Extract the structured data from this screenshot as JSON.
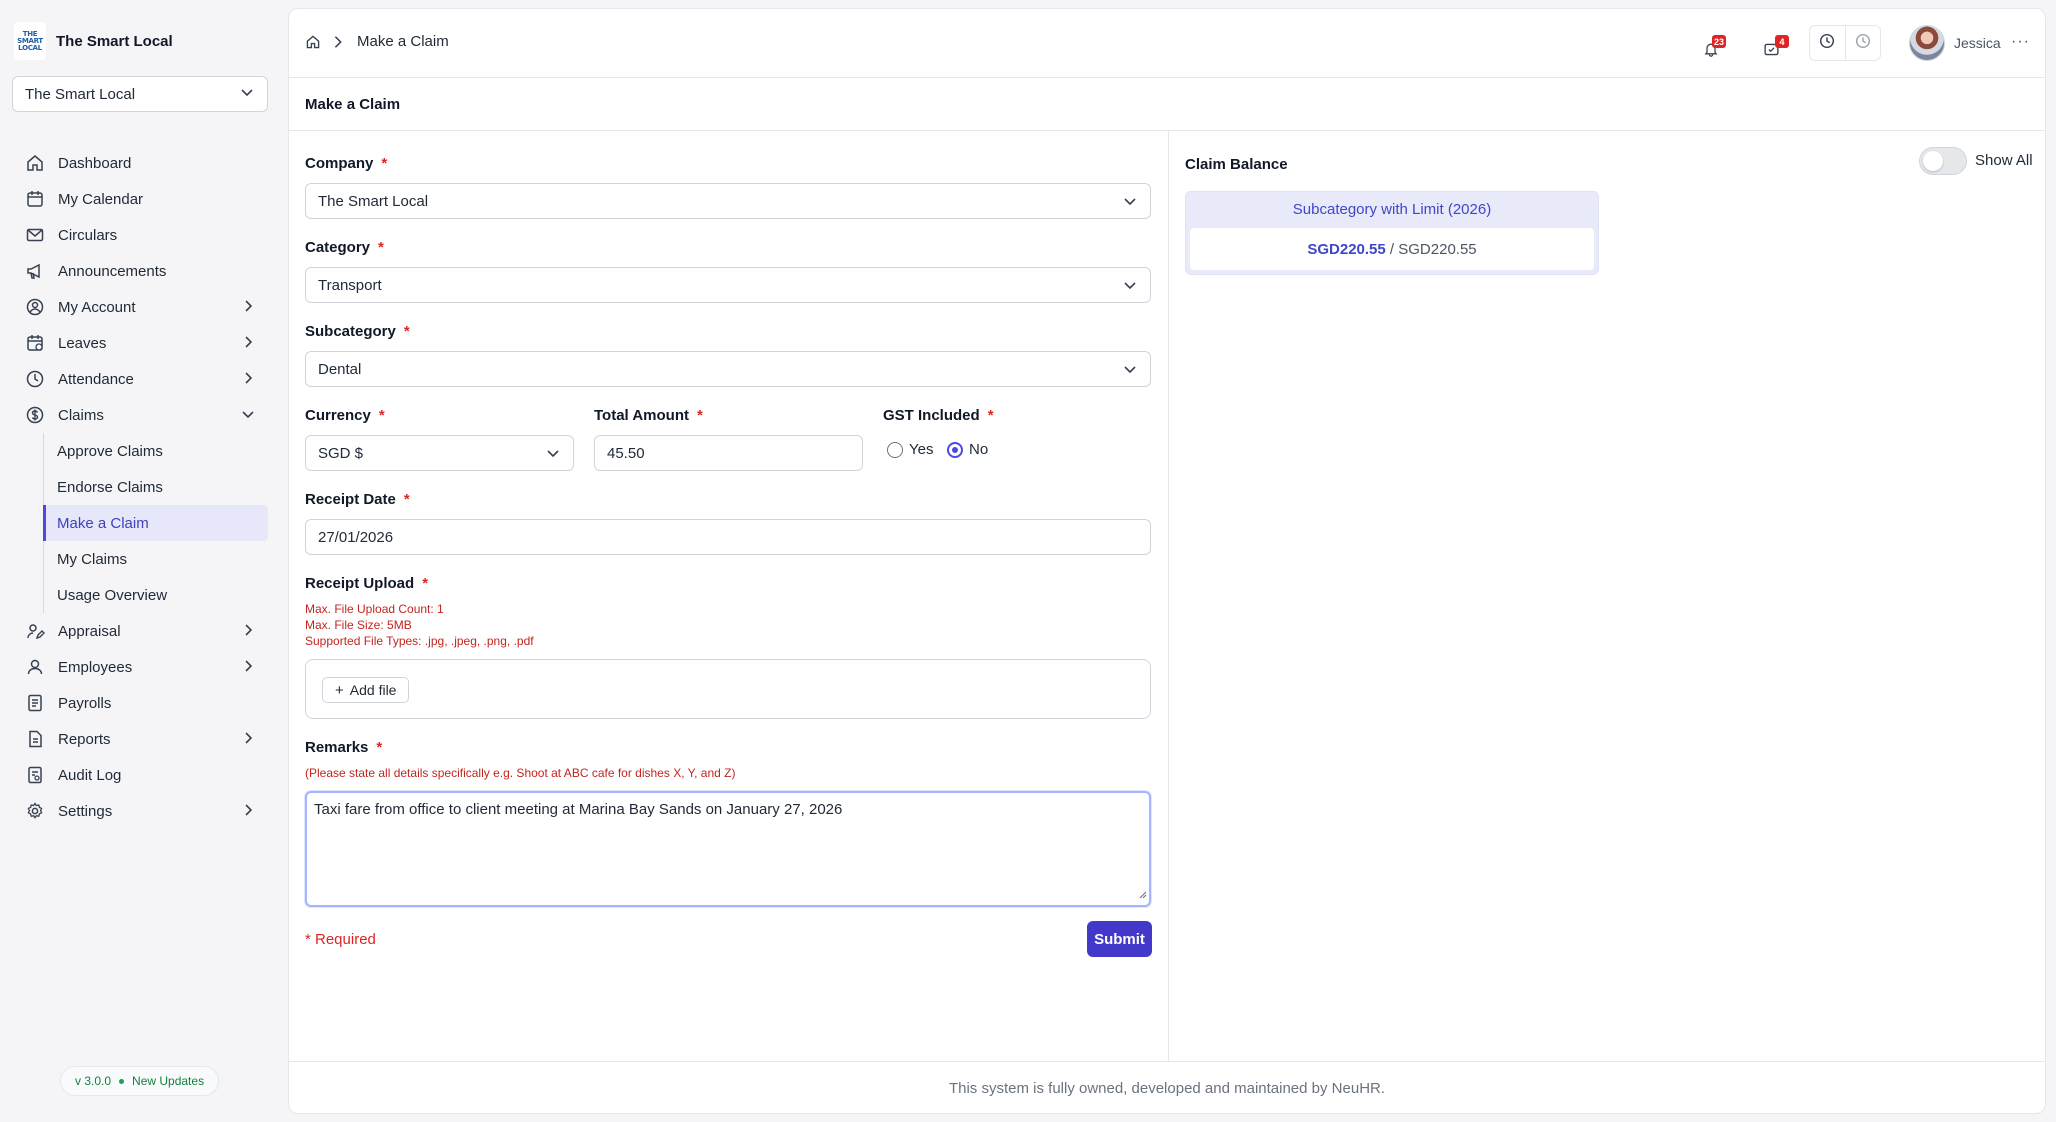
{
  "brand": {
    "logo_text": [
      "THE",
      "SMART",
      "LOCAL"
    ],
    "name": "The Smart Local"
  },
  "company_switcher": {
    "value": "The Smart Local"
  },
  "sidebar": {
    "items": [
      {
        "label": "Dashboard",
        "icon": "home-icon"
      },
      {
        "label": "My Calendar",
        "icon": "calendar-icon"
      },
      {
        "label": "Circulars",
        "icon": "mail-icon"
      },
      {
        "label": "Announcements",
        "icon": "megaphone-icon"
      },
      {
        "label": "My Account",
        "icon": "user-circle-icon"
      },
      {
        "label": "Leaves",
        "icon": "calendar-leave-icon"
      },
      {
        "label": "Attendance",
        "icon": "clock-icon"
      },
      {
        "label": "Claims",
        "icon": "dollar-circle-icon"
      },
      {
        "label": "Appraisal",
        "icon": "user-edit-icon"
      },
      {
        "label": "Employees",
        "icon": "user-icon"
      },
      {
        "label": "Payrolls",
        "icon": "receipt-icon"
      },
      {
        "label": "Reports",
        "icon": "report-icon"
      },
      {
        "label": "Audit Log",
        "icon": "audit-icon"
      },
      {
        "label": "Settings",
        "icon": "gear-icon"
      }
    ],
    "claims_sub": [
      "Approve Claims",
      "Endorse Claims",
      "Make a Claim",
      "My Claims",
      "Usage Overview"
    ],
    "version": "v 3.0.0",
    "updates": "New Updates"
  },
  "header": {
    "breadcrumb": "Make a Claim",
    "notifications_count": "23",
    "tasks_count": "4",
    "user_name": "Jessica",
    "more": "···"
  },
  "page": {
    "title": "Make a Claim"
  },
  "form": {
    "company_label": "Company",
    "company_value": "The Smart Local",
    "category_label": "Category",
    "category_value": "Transport",
    "subcategory_label": "Subcategory",
    "subcategory_value": "Dental",
    "currency_label": "Currency",
    "currency_value": "SGD $",
    "amount_label": "Total Amount",
    "amount_value": "45.50",
    "gst_label": "GST Included",
    "gst_yes": "Yes",
    "gst_no": "No",
    "receipt_date_label": "Receipt Date",
    "receipt_date_value": "27/01/2026",
    "upload_label": "Receipt Upload",
    "upload_hints": [
      "Max. File Upload Count: 1",
      "Max. File Size: 5MB",
      "Supported File Types: .jpg, .jpeg, .png, .pdf"
    ],
    "add_file": "Add file",
    "remarks_label": "Remarks",
    "remarks_hint": "(Please state all details specifically e.g. Shoot at ABC cafe for dishes X, Y, and Z)",
    "remarks_value": "Taxi fare from office to client meeting at Marina Bay Sands on January 27, 2026",
    "required_note": "* Required",
    "submit": "Submit",
    "required_mark": "*"
  },
  "balance": {
    "title": "Claim Balance",
    "show_all": "Show All",
    "card_title": "Subcategory with Limit (2026)",
    "used": "SGD220.55",
    "separator": " / ",
    "limit": "SGD220.55"
  },
  "footer": {
    "text": "This system is fully owned, developed and maintained by NeuHR."
  },
  "colors": {
    "accent": "#4338ca",
    "required": "#dc2626",
    "active_bg": "#e6e7f8"
  }
}
